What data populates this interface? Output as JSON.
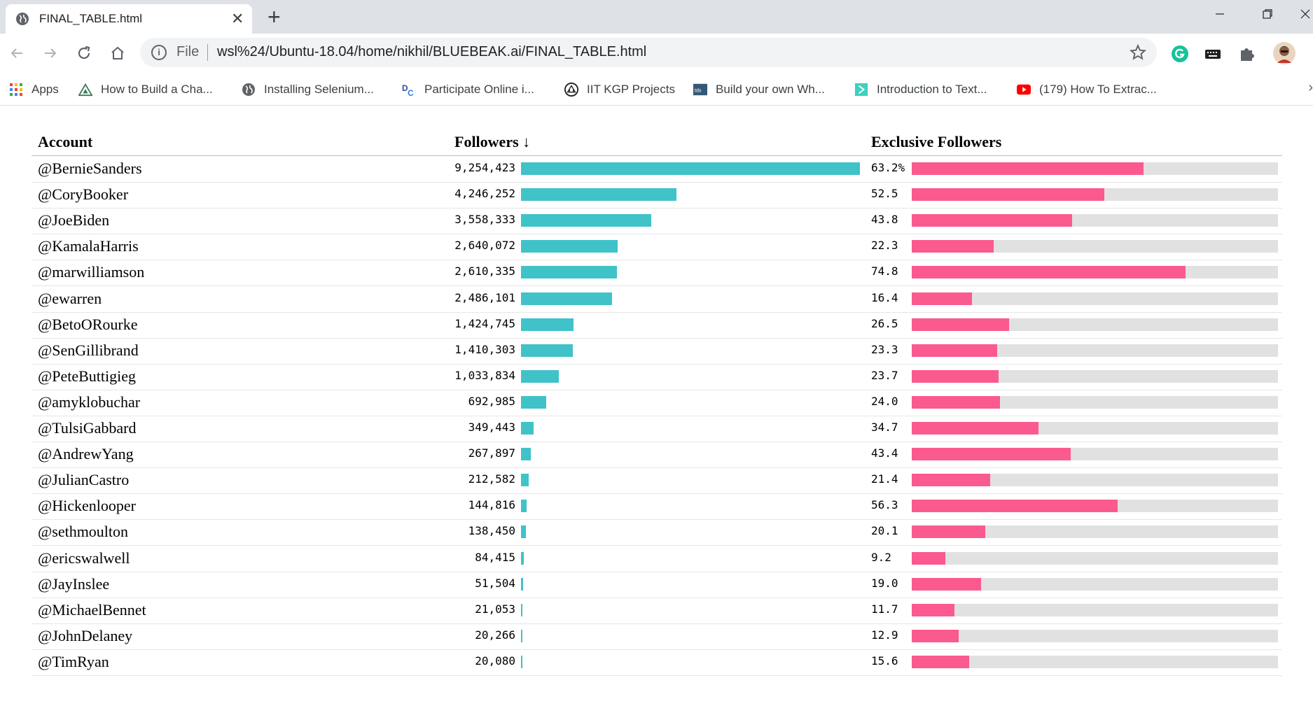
{
  "browser": {
    "tab_title": "FINAL_TABLE.html",
    "tab_close": "✕",
    "new_tab": "+",
    "scheme_label": "File",
    "url": "wsl%24/Ubuntu-18.04/home/nikhil/BLUEBEAK.ai/FINAL_TABLE.html",
    "bookmarks": [
      "Apps",
      "How to Build a Cha...",
      "Installing Selenium...",
      "Participate Online i...",
      "IIT KGP Projects",
      "Build your own Wh...",
      "Introduction to Text...",
      "(179) How To Extrac..."
    ],
    "bookmarks_more": "›"
  },
  "table": {
    "headers": {
      "account": "Account",
      "followers": "Followers ↓",
      "exclusive": "Exclusive Followers"
    },
    "max_followers": 9254423,
    "rows": [
      {
        "account": "@BernieSanders",
        "followers": "9,254,423",
        "followers_value": 9254423,
        "exclusive": "63.2%",
        "exclusive_value": 63.2
      },
      {
        "account": "@CoryBooker",
        "followers": "4,246,252",
        "followers_value": 4246252,
        "exclusive": "52.5",
        "exclusive_value": 52.5
      },
      {
        "account": "@JoeBiden",
        "followers": "3,558,333",
        "followers_value": 3558333,
        "exclusive": "43.8",
        "exclusive_value": 43.8
      },
      {
        "account": "@KamalaHarris",
        "followers": "2,640,072",
        "followers_value": 2640072,
        "exclusive": "22.3",
        "exclusive_value": 22.3
      },
      {
        "account": "@marwilliamson",
        "followers": "2,610,335",
        "followers_value": 2610335,
        "exclusive": "74.8",
        "exclusive_value": 74.8
      },
      {
        "account": "@ewarren",
        "followers": "2,486,101",
        "followers_value": 2486101,
        "exclusive": "16.4",
        "exclusive_value": 16.4
      },
      {
        "account": "@BetoORourke",
        "followers": "1,424,745",
        "followers_value": 1424745,
        "exclusive": "26.5",
        "exclusive_value": 26.5
      },
      {
        "account": "@SenGillibrand",
        "followers": "1,410,303",
        "followers_value": 1410303,
        "exclusive": "23.3",
        "exclusive_value": 23.3
      },
      {
        "account": "@PeteButtigieg",
        "followers": "1,033,834",
        "followers_value": 1033834,
        "exclusive": "23.7",
        "exclusive_value": 23.7
      },
      {
        "account": "@amyklobuchar",
        "followers": "692,985",
        "followers_value": 692985,
        "exclusive": "24.0",
        "exclusive_value": 24.0
      },
      {
        "account": "@TulsiGabbard",
        "followers": "349,443",
        "followers_value": 349443,
        "exclusive": "34.7",
        "exclusive_value": 34.7
      },
      {
        "account": "@AndrewYang",
        "followers": "267,897",
        "followers_value": 267897,
        "exclusive": "43.4",
        "exclusive_value": 43.4
      },
      {
        "account": "@JulianCastro",
        "followers": "212,582",
        "followers_value": 212582,
        "exclusive": "21.4",
        "exclusive_value": 21.4
      },
      {
        "account": "@Hickenlooper",
        "followers": "144,816",
        "followers_value": 144816,
        "exclusive": "56.3",
        "exclusive_value": 56.3
      },
      {
        "account": "@sethmoulton",
        "followers": "138,450",
        "followers_value": 138450,
        "exclusive": "20.1",
        "exclusive_value": 20.1
      },
      {
        "account": "@ericswalwell",
        "followers": "84,415",
        "followers_value": 84415,
        "exclusive": "9.2",
        "exclusive_value": 9.2
      },
      {
        "account": "@JayInslee",
        "followers": "51,504",
        "followers_value": 51504,
        "exclusive": "19.0",
        "exclusive_value": 19.0
      },
      {
        "account": "@MichaelBennet",
        "followers": "21,053",
        "followers_value": 21053,
        "exclusive": "11.7",
        "exclusive_value": 11.7
      },
      {
        "account": "@JohnDelaney",
        "followers": "20,266",
        "followers_value": 20266,
        "exclusive": "12.9",
        "exclusive_value": 12.9
      },
      {
        "account": "@TimRyan",
        "followers": "20,080",
        "followers_value": 20080,
        "exclusive": "15.6",
        "exclusive_value": 15.6
      }
    ]
  },
  "colors": {
    "followers_bar": "#40c2c9",
    "exclusive_bar": "#fb5a8e",
    "exclusive_track": "#e1e1e1"
  }
}
